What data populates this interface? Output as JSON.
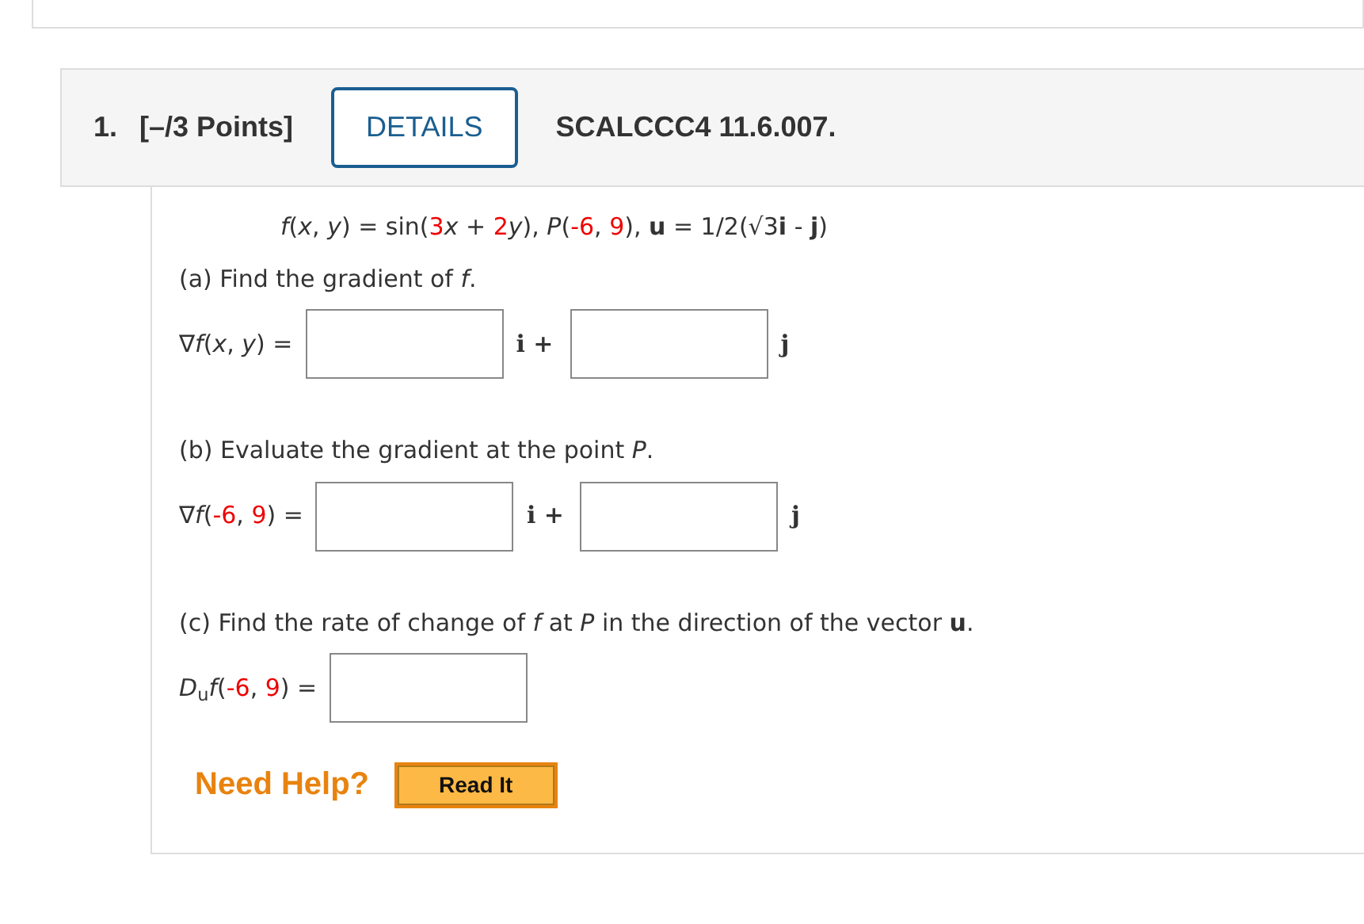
{
  "question": {
    "number": "1.",
    "points": "[–/3 Points]",
    "details_button": "DETAILS",
    "code": "SCALCCC4 11.6.007."
  },
  "formula": [
    {
      "text": "*f*(*x*, *y*) = sin(",
      "random": false
    },
    {
      "text": "3",
      "random": true
    },
    {
      "text": "*x* + ",
      "random": false
    },
    {
      "text": "2",
      "random": true
    },
    {
      "text": "*y*), *P*(",
      "random": false
    },
    {
      "text": "-6",
      "random": true
    },
    {
      "text": ", ",
      "random": false
    },
    {
      "text": "9",
      "random": true
    },
    {
      "text": "), **u** = 1/2(√3**i** - **j**)",
      "random": false
    }
  ],
  "parts": [
    {
      "prompt": "(a) Find the gradient of *f*.",
      "lhs": [
        {
          "text": "∇*f*(*x*, *y*) =",
          "random": false
        }
      ],
      "blanks": [
        {
          "kind": "component",
          "suffix": "i +"
        },
        {
          "kind": "component",
          "suffix": "j"
        }
      ]
    },
    {
      "prompt": "(b) Evaluate the gradient at the point *P*.",
      "lhs": [
        {
          "text": "∇*f*(",
          "random": false
        },
        {
          "text": "-6",
          "random": true
        },
        {
          "text": ", ",
          "random": false
        },
        {
          "text": "9",
          "random": true
        },
        {
          "text": ") =",
          "random": false
        }
      ],
      "blanks": [
        {
          "kind": "component",
          "suffix": "i +"
        },
        {
          "kind": "component",
          "suffix": "j"
        }
      ]
    },
    {
      "prompt": "(c) Find the rate of change of *f* at *P* in the direction of the vector **u**.",
      "lhs": [
        {
          "text": "*D*$_{u}$*f*(",
          "random": false
        },
        {
          "text": "-6",
          "random": true
        },
        {
          "text": ", ",
          "random": false
        },
        {
          "text": "9",
          "random": true
        },
        {
          "text": ") =",
          "random": false
        }
      ],
      "blanks": [
        {
          "kind": "scalar"
        }
      ]
    }
  ],
  "help": {
    "label": "Need Help?",
    "button": "Read It"
  }
}
